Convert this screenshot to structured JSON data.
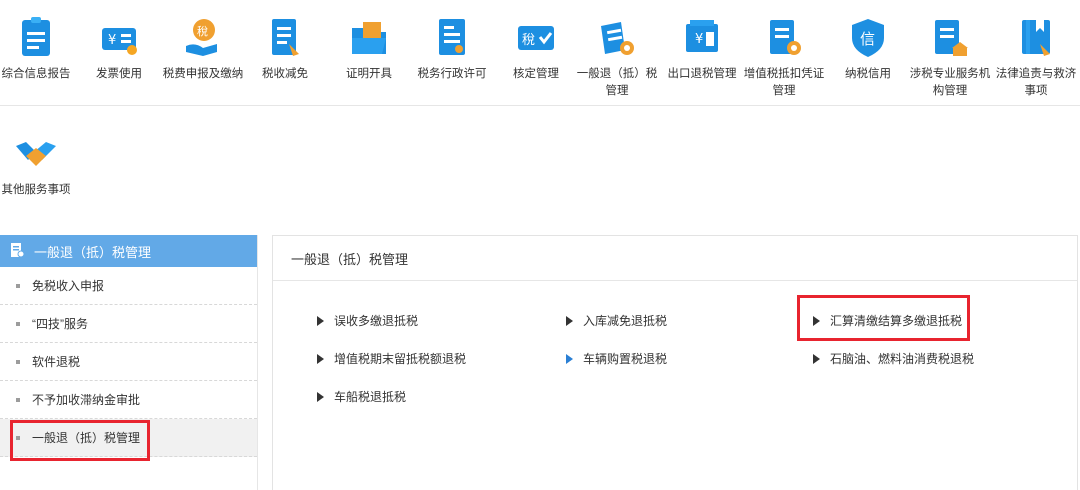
{
  "services": [
    {
      "label": "综合信息报告",
      "icon": "report-icon"
    },
    {
      "label": "发票使用",
      "icon": "invoice-icon"
    },
    {
      "label": "税费申报及缴纳",
      "icon": "tax-declare-icon"
    },
    {
      "label": "税收减免",
      "icon": "tax-relief-icon"
    },
    {
      "label": "证明开具",
      "icon": "certificate-folder-icon"
    },
    {
      "label": "税务行政许可",
      "icon": "license-icon"
    },
    {
      "label": "核定管理",
      "icon": "tax-verify-icon"
    },
    {
      "label": "一般退（抵）税管理",
      "icon": "refund-docs-icon"
    },
    {
      "label": "出口退税管理",
      "icon": "export-refund-icon"
    },
    {
      "label": "增值税抵扣凭证管理",
      "icon": "vat-voucher-icon"
    },
    {
      "label": "纳税信用",
      "icon": "credit-shield-icon"
    },
    {
      "label": "涉税专业服务机构管理",
      "icon": "agency-icon"
    },
    {
      "label": "法律追责与救济事项",
      "icon": "law-book-icon"
    }
  ],
  "other_service": {
    "label": "其他服务事项",
    "icon": "handshake-icon"
  },
  "sidebar": {
    "title": "一般退（抵）税管理",
    "items": [
      {
        "label": "免税收入申报"
      },
      {
        "label": "“四技”服务"
      },
      {
        "label": "软件退税"
      },
      {
        "label": "不予加收滞纳金审批"
      },
      {
        "label": "一般退（抵）税管理"
      }
    ]
  },
  "panel": {
    "title": "一般退（抵）税管理",
    "links": [
      {
        "label": "误收多缴退抵税"
      },
      {
        "label": "入库减免退抵税"
      },
      {
        "label": "汇算清缴结算多缴退抵税"
      },
      {
        "label": "增值税期末留抵税额退税"
      },
      {
        "label": "车辆购置税退税"
      },
      {
        "label": "石脑油、燃料油消费税退税"
      },
      {
        "label": "车船税退抵税"
      }
    ]
  },
  "colors": {
    "accent": "#2a8ae0",
    "sidebar_header": "#62a9e7",
    "highlight": "#e8242f"
  }
}
